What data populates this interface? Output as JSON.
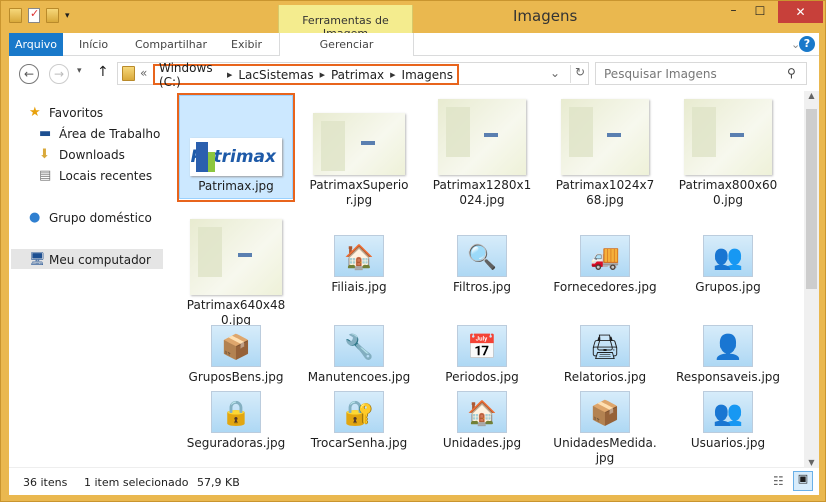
{
  "window": {
    "title": "Imagens",
    "context_tab": "Ferramentas de Imagem",
    "minimize": "–",
    "maximize": "☐",
    "close": "✕"
  },
  "ribbon": {
    "tabs": [
      "Arquivo",
      "Início",
      "Compartilhar",
      "Exibir"
    ],
    "context_group": "Gerenciar",
    "help": "?",
    "expand": "⌄"
  },
  "nav": {
    "back": "←",
    "forward": "→",
    "recent": "▾",
    "up": "↑",
    "overflow": "«",
    "breadcrumb": [
      "Windows (C:)",
      "LacSistemas",
      "Patrimax",
      "Imagens"
    ],
    "refresh": "↻",
    "dropdown": "⌄",
    "search_placeholder": "Pesquisar Imagens"
  },
  "sidebar": {
    "items": [
      {
        "label": "Favoritos",
        "icon": "star-icon",
        "level": 0
      },
      {
        "label": "Área de Trabalho",
        "icon": "desktop-icon",
        "level": 1
      },
      {
        "label": "Downloads",
        "icon": "downloads-icon",
        "level": 1
      },
      {
        "label": "Locais recentes",
        "icon": "recent-places-icon",
        "level": 1
      },
      {
        "label": "Grupo doméstico",
        "icon": "homegroup-icon",
        "level": 0
      },
      {
        "label": "Meu computador",
        "icon": "computer-icon",
        "level": 0
      }
    ]
  },
  "files": [
    {
      "name": "Patrimax.jpg",
      "kind": "logo",
      "selected": true
    },
    {
      "name": "PatrimaxSuperior.jpg",
      "kind": "thumb-wide"
    },
    {
      "name": "Patrimax1280x1024.jpg",
      "kind": "thumb"
    },
    {
      "name": "Patrimax1024x768.jpg",
      "kind": "thumb"
    },
    {
      "name": "Patrimax800x600.jpg",
      "kind": "thumb"
    },
    {
      "name": "Patrimax640x480.jpg",
      "kind": "thumb"
    },
    {
      "name": "Filiais.jpg",
      "kind": "icon",
      "glyph": "🏠"
    },
    {
      "name": "Filtros.jpg",
      "kind": "icon",
      "glyph": "🔍"
    },
    {
      "name": "Fornecedores.jpg",
      "kind": "icon",
      "glyph": "🚚"
    },
    {
      "name": "Grupos.jpg",
      "kind": "icon",
      "glyph": "👥"
    },
    {
      "name": "GruposBens.jpg",
      "kind": "icon",
      "glyph": "📦"
    },
    {
      "name": "Manutencoes.jpg",
      "kind": "icon",
      "glyph": "🔧"
    },
    {
      "name": "Periodos.jpg",
      "kind": "icon",
      "glyph": "📅"
    },
    {
      "name": "Relatorios.jpg",
      "kind": "icon",
      "glyph": "🖨"
    },
    {
      "name": "Responsaveis.jpg",
      "kind": "icon",
      "glyph": "👤"
    },
    {
      "name": "Seguradoras.jpg",
      "kind": "icon",
      "glyph": "🔒"
    },
    {
      "name": "TrocarSenha.jpg",
      "kind": "icon",
      "glyph": "🔐"
    },
    {
      "name": "Unidades.jpg",
      "kind": "icon",
      "glyph": "🏠"
    },
    {
      "name": "UnidadesMedida.jpg",
      "kind": "icon",
      "glyph": "📦"
    },
    {
      "name": "Usuarios.jpg",
      "kind": "icon",
      "glyph": "👥"
    }
  ],
  "status": {
    "count": "36 itens",
    "selection": "1 item selecionado",
    "size": "57,9 KB"
  },
  "colors": {
    "frame": "#eab84f",
    "accent": "#1979ca",
    "highlight": "#e8641c",
    "selection": "#cce8ff"
  }
}
